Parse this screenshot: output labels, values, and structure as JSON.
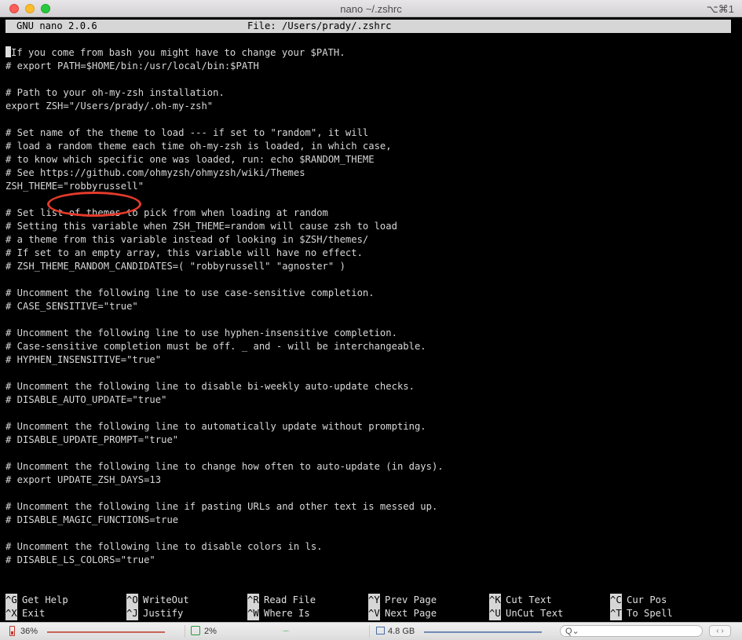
{
  "window": {
    "title": "nano ~/.zshrc",
    "shortcut": "⌥⌘1"
  },
  "nano": {
    "version": "GNU nano 2.0.6",
    "file": "File: /Users/prady/.zshrc"
  },
  "editor": {
    "lines": [
      " If you come from bash you might have to change your $PATH.",
      "# export PATH=$HOME/bin:/usr/local/bin:$PATH",
      "",
      "# Path to your oh-my-zsh installation.",
      "export ZSH=\"/Users/prady/.oh-my-zsh\"",
      "",
      "# Set name of the theme to load --- if set to \"random\", it will",
      "# load a random theme each time oh-my-zsh is loaded, in which case,",
      "# to know which specific one was loaded, run: echo $RANDOM_THEME",
      "# See https://github.com/ohmyzsh/ohmyzsh/wiki/Themes",
      "ZSH_THEME=\"robbyrussell\"",
      "",
      "# Set list of themes to pick from when loading at random",
      "# Setting this variable when ZSH_THEME=random will cause zsh to load",
      "# a theme from this variable instead of looking in $ZSH/themes/",
      "# If set to an empty array, this variable will have no effect.",
      "# ZSH_THEME_RANDOM_CANDIDATES=( \"robbyrussell\" \"agnoster\" )",
      "",
      "# Uncomment the following line to use case-sensitive completion.",
      "# CASE_SENSITIVE=\"true\"",
      "",
      "# Uncomment the following line to use hyphen-insensitive completion.",
      "# Case-sensitive completion must be off. _ and - will be interchangeable.",
      "# HYPHEN_INSENSITIVE=\"true\"",
      "",
      "# Uncomment the following line to disable bi-weekly auto-update checks.",
      "# DISABLE_AUTO_UPDATE=\"true\"",
      "",
      "# Uncomment the following line to automatically update without prompting.",
      "# DISABLE_UPDATE_PROMPT=\"true\"",
      "",
      "# Uncomment the following line to change how often to auto-update (in days).",
      "# export UPDATE_ZSH_DAYS=13",
      "",
      "# Uncomment the following line if pasting URLs and other text is messed up.",
      "# DISABLE_MAGIC_FUNCTIONS=true",
      "",
      "# Uncomment the following line to disable colors in ls.",
      "# DISABLE_LS_COLORS=\"true\""
    ]
  },
  "shortcuts": [
    {
      "key": "^G",
      "label": "Get Help"
    },
    {
      "key": "^O",
      "label": "WriteOut"
    },
    {
      "key": "^R",
      "label": "Read File"
    },
    {
      "key": "^Y",
      "label": "Prev Page"
    },
    {
      "key": "^K",
      "label": "Cut Text"
    },
    {
      "key": "^C",
      "label": "Cur Pos"
    },
    {
      "key": "^X",
      "label": "Exit"
    },
    {
      "key": "^J",
      "label": "Justify"
    },
    {
      "key": "^W",
      "label": "Where Is"
    },
    {
      "key": "^V",
      "label": "Next Page"
    },
    {
      "key": "^U",
      "label": "UnCut Text"
    },
    {
      "key": "^T",
      "label": "To Spell"
    }
  ],
  "statusbar": {
    "battery": "36%",
    "cpu": "2%",
    "memory": "4.8 GB",
    "search_glyph": "Q⌄",
    "nav_arrows": "‹ ›",
    "colors": {
      "battery": "#c0392b",
      "cpu": "#2a9d3a",
      "memory": "#4a6fa5"
    }
  },
  "annotation": {
    "color": "#e43a2b",
    "target": "robbyrussell"
  }
}
